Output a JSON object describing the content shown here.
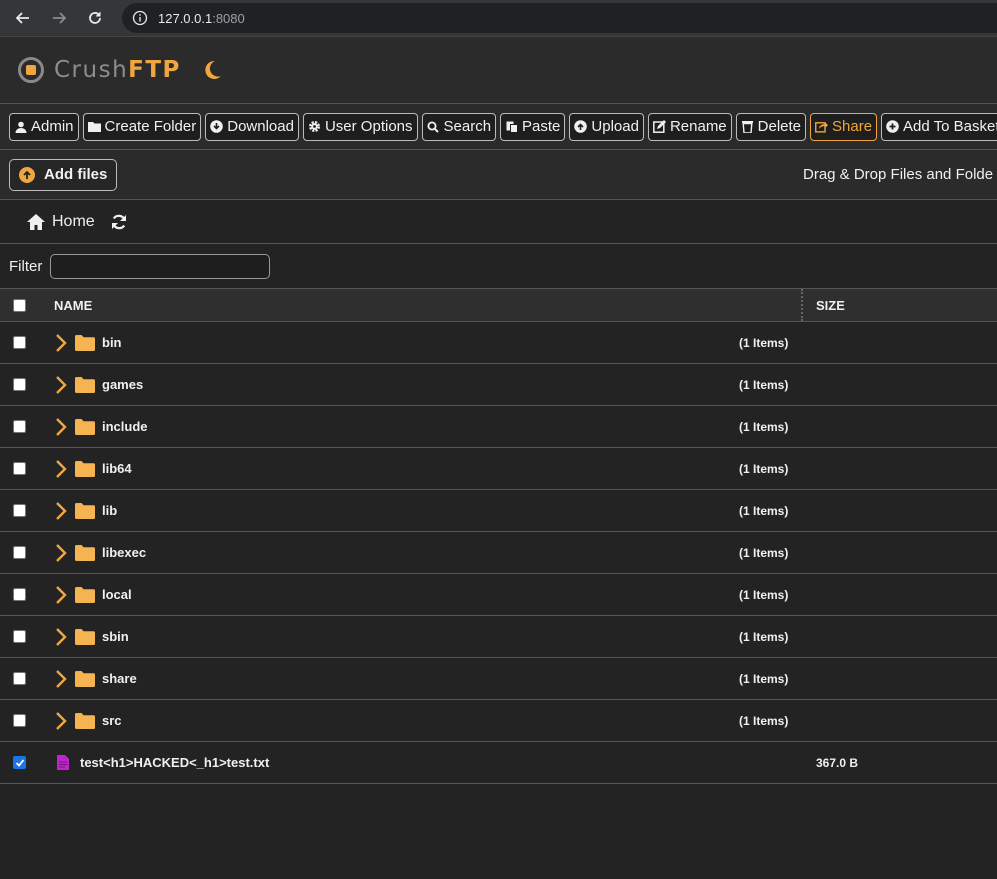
{
  "browser": {
    "url_host": "127.0.0.1",
    "url_port": ":8080"
  },
  "app": {
    "logo_part1": "Crush",
    "logo_part2": "FTP",
    "accent_color": "#f0a640"
  },
  "toolbar": {
    "buttons": [
      {
        "label": "Admin",
        "icon": "user-icon"
      },
      {
        "label": "Create Folder",
        "icon": "folder-icon"
      },
      {
        "label": "Download",
        "icon": "download-icon"
      },
      {
        "label": "User Options",
        "icon": "gear-icon"
      },
      {
        "label": "Search",
        "icon": "search-icon"
      },
      {
        "label": "Paste",
        "icon": "paste-icon"
      },
      {
        "label": "Upload",
        "icon": "upload-icon"
      },
      {
        "label": "Rename",
        "icon": "edit-icon"
      },
      {
        "label": "Delete",
        "icon": "trash-icon"
      },
      {
        "label": "Share",
        "icon": "share-icon"
      },
      {
        "label": "Add To Basket",
        "icon": "plus-circle-icon"
      }
    ]
  },
  "upload": {
    "add_files_label": "Add files",
    "drag_drop_text": "Drag & Drop Files and Folde"
  },
  "breadcrumb": {
    "home_label": "Home"
  },
  "filter": {
    "label": "Filter",
    "value": ""
  },
  "table": {
    "headers": {
      "name": "NAME",
      "size": "SIZE"
    },
    "folders": [
      {
        "name": "bin",
        "items": "(1 Items)"
      },
      {
        "name": "games",
        "items": "(1 Items)"
      },
      {
        "name": "include",
        "items": "(1 Items)"
      },
      {
        "name": "lib64",
        "items": "(1 Items)"
      },
      {
        "name": "lib",
        "items": "(1 Items)"
      },
      {
        "name": "libexec",
        "items": "(1 Items)"
      },
      {
        "name": "local",
        "items": "(1 Items)"
      },
      {
        "name": "sbin",
        "items": "(1 Items)"
      },
      {
        "name": "share",
        "items": "(1 Items)"
      },
      {
        "name": "src",
        "items": "(1 Items)"
      }
    ],
    "files": [
      {
        "name": "test<h1>HACKED<_h1>test.txt",
        "size": "367.0 B",
        "checked": true
      }
    ]
  }
}
